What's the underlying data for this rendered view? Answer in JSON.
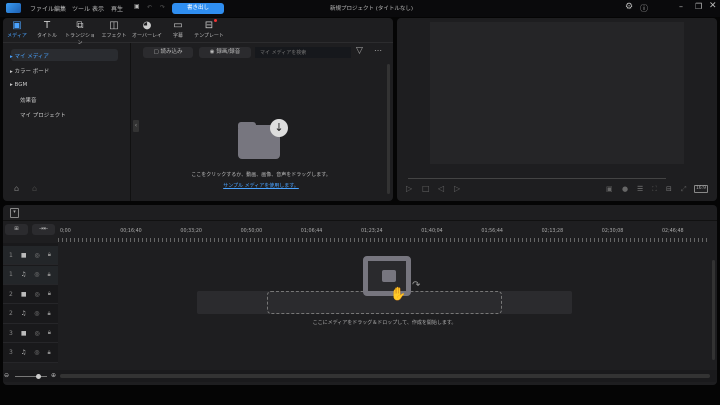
{
  "app": {
    "title": "新規プロジェクト (タイトルなし)",
    "export_label": "書き出し"
  },
  "menu": [
    "ファイル",
    "編集",
    "ツール",
    "表示",
    "再生"
  ],
  "tabs": [
    {
      "label": "メディア",
      "icon": "media-icon",
      "active": true
    },
    {
      "label": "タイトル",
      "icon": "title-icon"
    },
    {
      "label": "トランジション",
      "icon": "transition-icon"
    },
    {
      "label": "エフェクト",
      "icon": "effect-icon"
    },
    {
      "label": "オーバーレイ",
      "icon": "overlay-icon"
    },
    {
      "label": "字幕",
      "icon": "subtitle-icon"
    },
    {
      "label": "テンプレート",
      "icon": "template-icon"
    }
  ],
  "sidebar": [
    "マイ メディア",
    "カラー ボード",
    "BGM",
    "効果音",
    "マイ プロジェクト"
  ],
  "media": {
    "import_label": "読み込み",
    "record_label": "録画/録音",
    "search_placeholder": "マイ メディアを検索",
    "empty_text": "ここをクリックするか、動画、画像、音声をドラッグします。",
    "sample_link": "サンプル メディアを使用します。"
  },
  "preview": {
    "aspect_ratio": "16:9"
  },
  "timeline": {
    "ruler": [
      "0;00",
      "00;16;40",
      "00;33;20",
      "00;50;00",
      "01;06;44",
      "01;23;24",
      "01;40;04",
      "01;56;44",
      "02;13;28",
      "02;30;08",
      "02;46;48"
    ],
    "tracks": [
      {
        "num": "1",
        "type": "video"
      },
      {
        "num": "1",
        "type": "audio"
      },
      {
        "num": "2",
        "type": "video"
      },
      {
        "num": "2",
        "type": "audio"
      },
      {
        "num": "3",
        "type": "video"
      },
      {
        "num": "3",
        "type": "audio"
      }
    ],
    "drop_text": "ここにメディアをドラッグ＆ドロップして、作成を開始します。"
  }
}
